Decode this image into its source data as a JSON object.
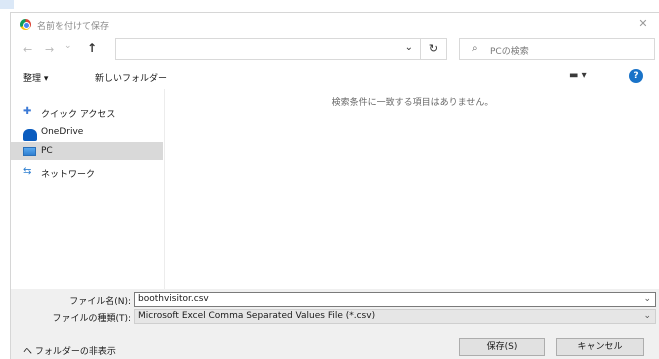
{
  "window": {
    "title": "名前を付けて保存",
    "close_glyph": "✕"
  },
  "address_bar": {
    "back_glyph": "←",
    "forward_glyph": "→",
    "recent_glyph": "⌄",
    "up_glyph": "↑",
    "path": "",
    "dropdown_glyph": "⌄",
    "refresh_glyph": "↻"
  },
  "search": {
    "placeholder": "PCの検索"
  },
  "toolbar": {
    "organize_label": "整理 ▾",
    "new_folder_label": "新しいフォルダー",
    "view_glyph": "▬ ▾",
    "help_glyph": "?"
  },
  "nav": {
    "items": [
      {
        "label": "クイック アクセス",
        "icon": "quick-access-pin-icon"
      },
      {
        "label": "OneDrive",
        "icon": "onedrive-cloud-icon"
      },
      {
        "label": "PC",
        "icon": "pc-monitor-icon",
        "selected": true
      },
      {
        "label": "ネットワーク",
        "icon": "network-icon"
      }
    ]
  },
  "content": {
    "empty_message": "検索条件に一致する項目はありません。"
  },
  "form": {
    "filename_label": "ファイル名(N):",
    "filename_value": "boothvisitor.csv",
    "filetype_label": "ファイルの種類(T):",
    "filetype_value": "Microsoft Excel Comma Separated Values File (*.csv)"
  },
  "footer": {
    "hide_folders_label": "ヘ フォルダーの非表示",
    "save_label": "保存(S)",
    "cancel_label": "キャンセル"
  }
}
